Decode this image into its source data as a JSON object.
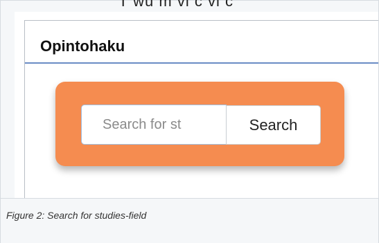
{
  "figure": {
    "top_cut_text": "T  wu  m  vi  c  vi  c",
    "caption": "Figure 2: Search for studies-field"
  },
  "panel": {
    "title": "Opintohaku"
  },
  "search": {
    "placeholder": "Search for st",
    "value": "",
    "button_label": "Search"
  },
  "colors": {
    "card_orange": "#f58c50",
    "divider_blue": "#6a8bc4",
    "input_border": "#9fc0e4"
  }
}
